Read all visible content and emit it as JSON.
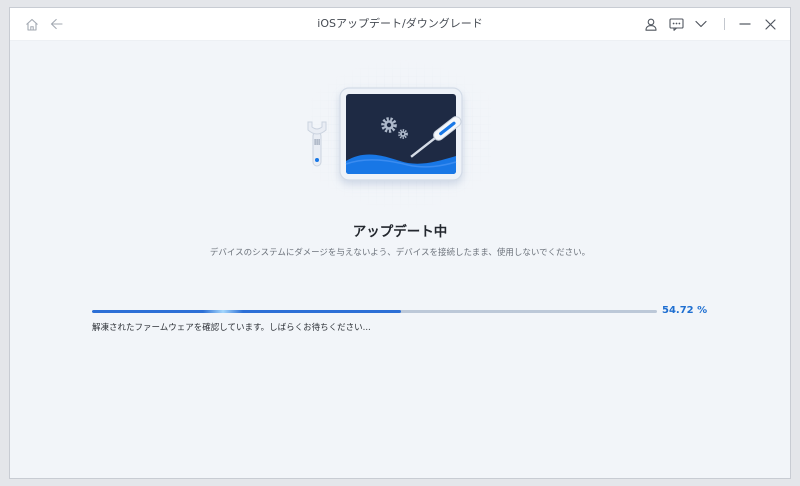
{
  "window": {
    "title": "iOSアップデート/ダウングレード"
  },
  "toolbar": {
    "icons": [
      "home-icon",
      "back-arrow-icon",
      "user-icon",
      "feedback-icon",
      "chevron-down-icon",
      "minimize-icon",
      "close-icon"
    ]
  },
  "main": {
    "heading": "アップデート中",
    "description": "デバイスのシステムにダメージを与えないよう、デバイスを接続したまま、使用しないでください。",
    "progress": {
      "percent": 54.72,
      "label": "54.72 %",
      "status": "解凍されたファームウェアを確認しています。しばらくお待ちください..."
    }
  },
  "colors": {
    "accent": "#2c6fd6",
    "track": "#bcc8d8",
    "screen": "#1e2a44",
    "wave": "#1877e6",
    "background": "#f2f5f9"
  }
}
